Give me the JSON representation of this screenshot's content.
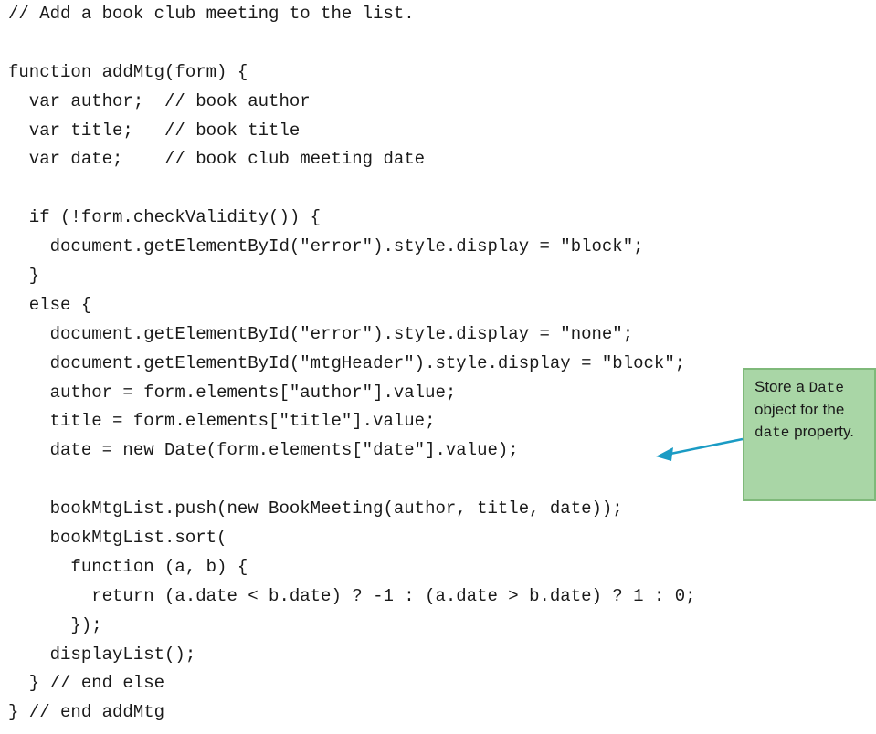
{
  "code_lines": [
    "// Add a book club meeting to the list.",
    "",
    "function addMtg(form) {",
    "  var author;  // book author",
    "  var title;   // book title",
    "  var date;    // book club meeting date",
    "",
    "  if (!form.checkValidity()) {",
    "    document.getElementById(\"error\").style.display = \"block\";",
    "  }",
    "  else {",
    "    document.getElementById(\"error\").style.display = \"none\";",
    "    document.getElementById(\"mtgHeader\").style.display = \"block\";",
    "    author = form.elements[\"author\"].value;",
    "    title = form.elements[\"title\"].value;",
    "    date = new Date(form.elements[\"date\"].value);",
    "",
    "    bookMtgList.push(new BookMeeting(author, title, date));",
    "    bookMtgList.sort(",
    "      function (a, b) {",
    "        return (a.date < b.date) ? -1 : (a.date > b.date) ? 1 : 0;",
    "      });",
    "    displayList();",
    "  } // end else",
    "} // end addMtg"
  ],
  "callout": {
    "part1": "Store a ",
    "code1": "Date",
    "part2": " object for the ",
    "code2": "date",
    "part3": " property."
  },
  "colors": {
    "callout_bg": "#a9d6a6",
    "callout_border": "#7fb97a",
    "arrow": "#1a9bc4"
  }
}
